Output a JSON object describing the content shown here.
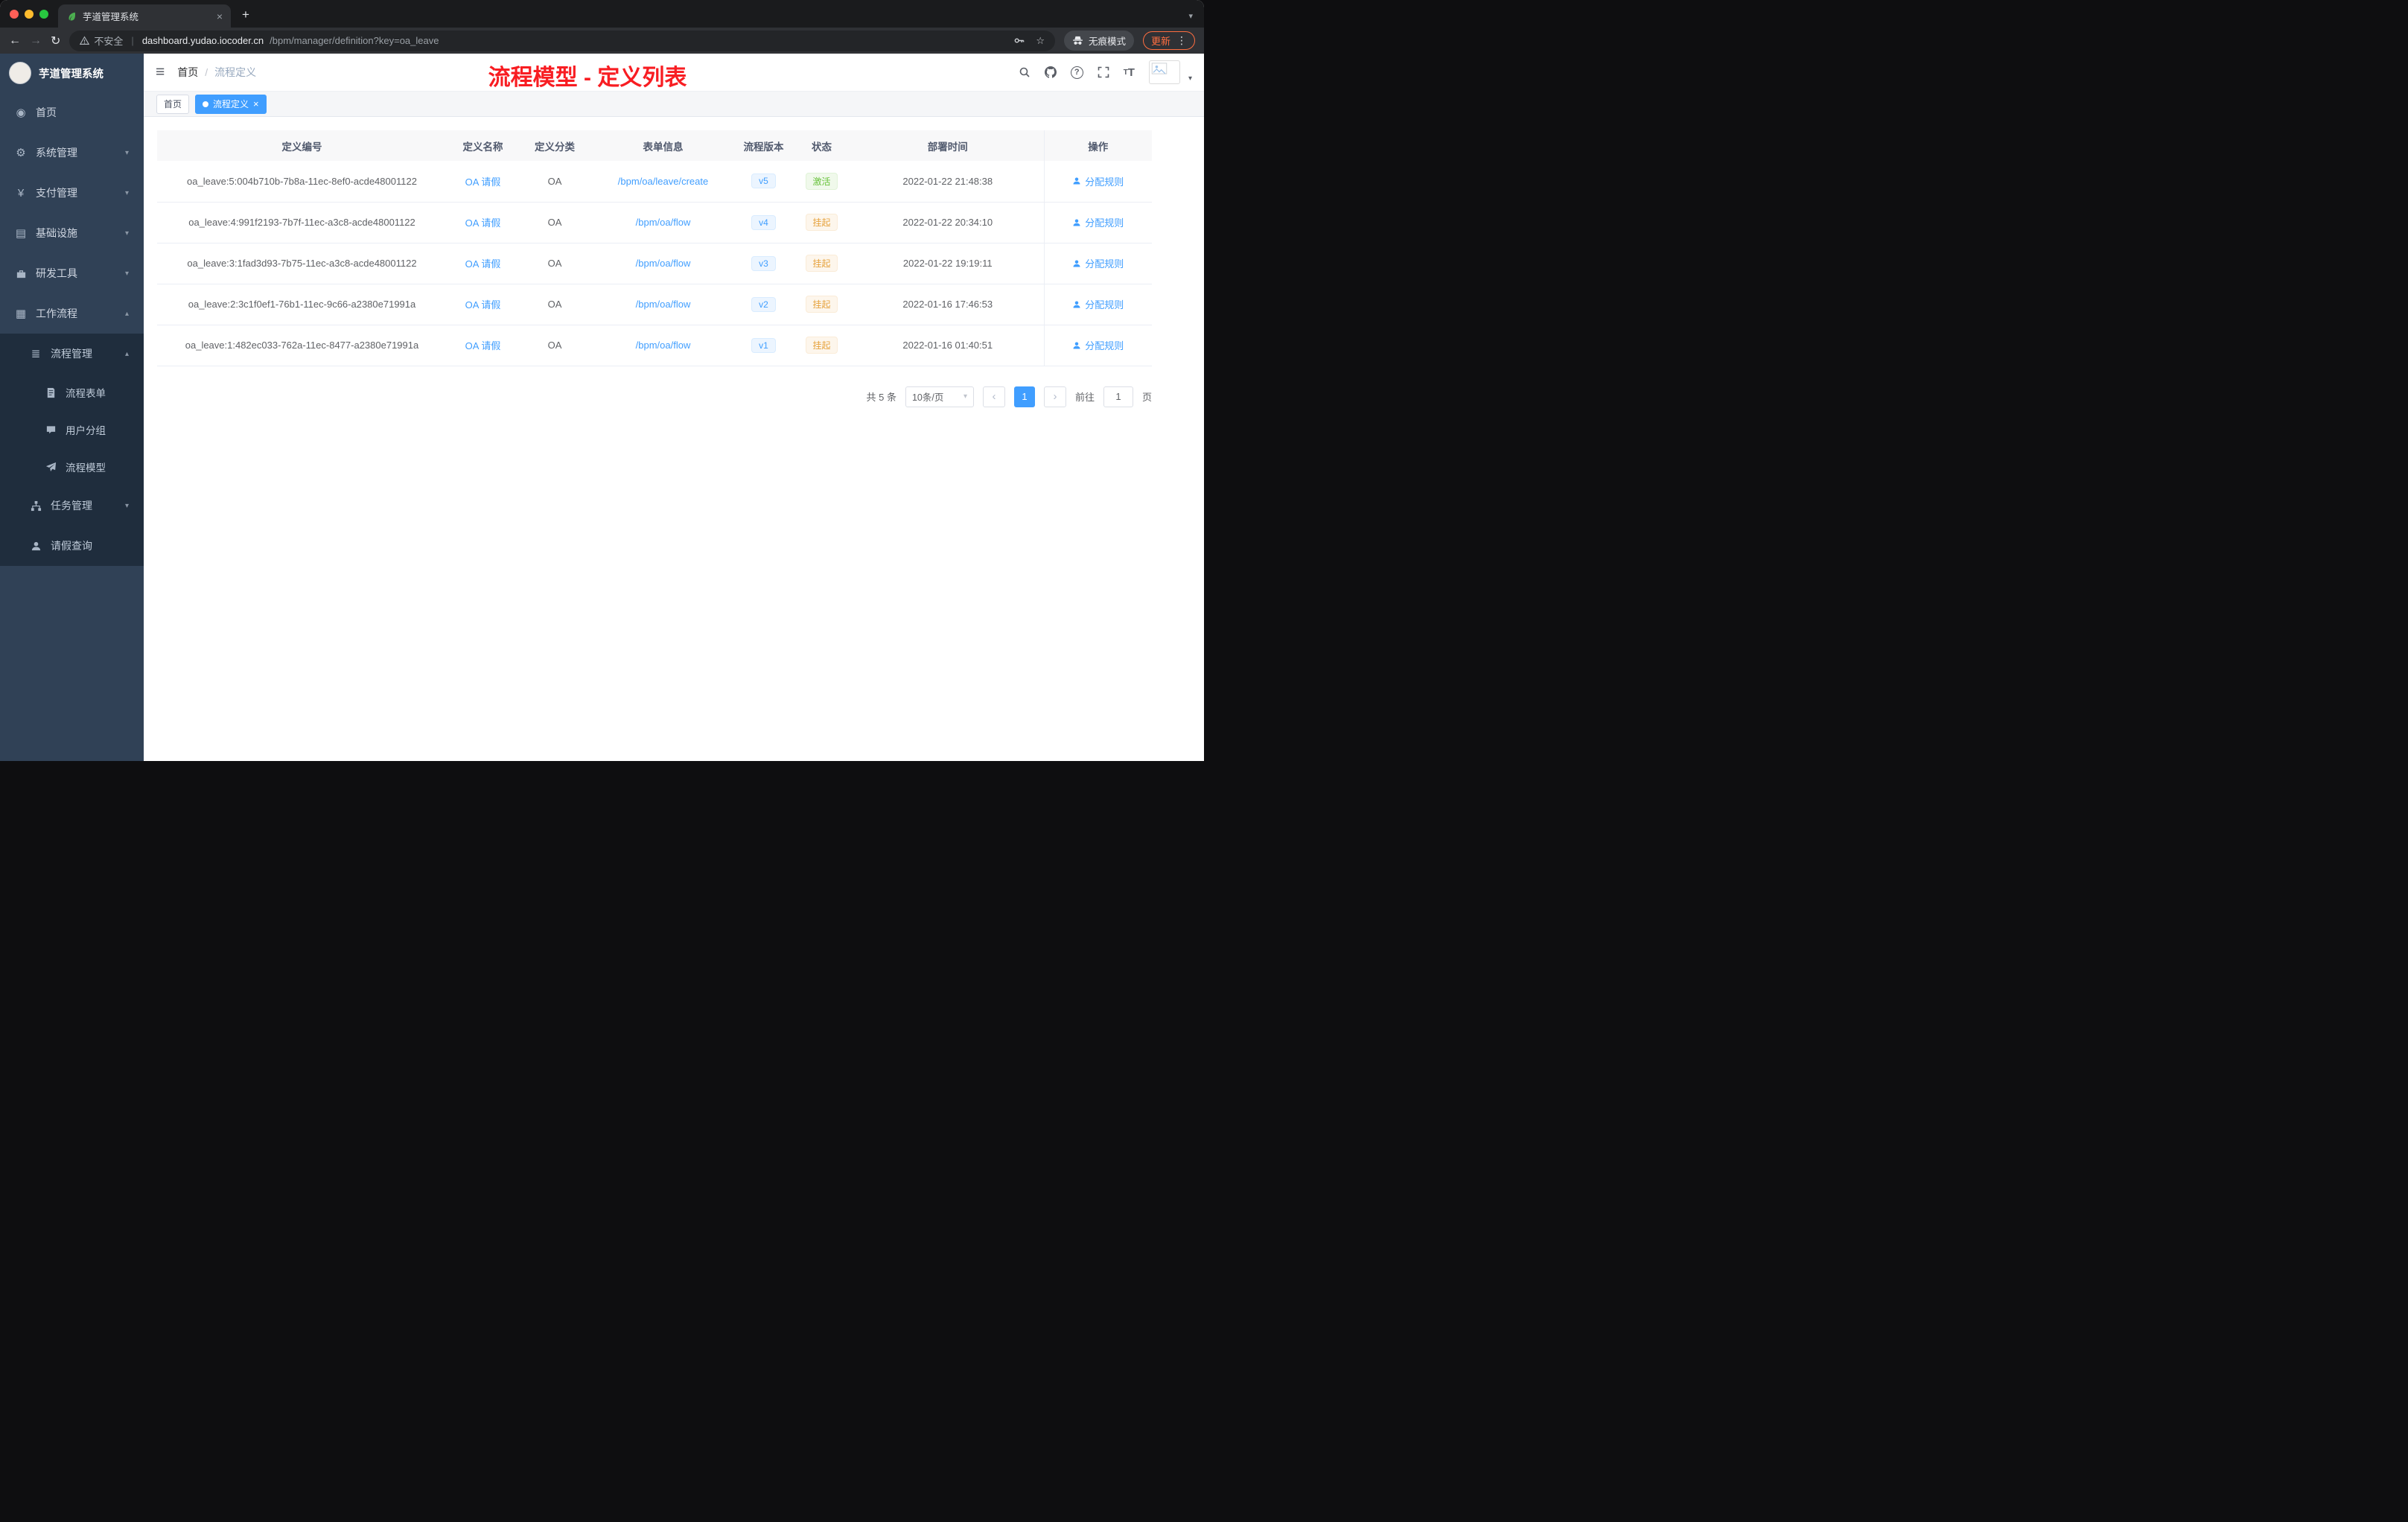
{
  "colors": {
    "accent": "#409eff",
    "title_red": "#f81d22",
    "success": "#67c23a",
    "warning": "#e6a23c",
    "sidebar_bg": "#304156",
    "submenu_bg": "#1f2d3d"
  },
  "browser": {
    "tab_title": "芋道管理系统",
    "security_label": "不安全",
    "url_host": "dashboard.yudao.iocoder.cn",
    "url_path": "/bpm/manager/definition?key=oa_leave",
    "incognito_label": "无痕模式",
    "update_label": "更新"
  },
  "icons": {
    "back": "←",
    "forward": "→",
    "reload": "↻",
    "star": "☆",
    "kebab": "⋮",
    "caret_down": "▾",
    "caret_up": "▴",
    "plus": "+",
    "close": "×",
    "question": "?",
    "hamburger": "≡",
    "prev": "‹",
    "next": "›",
    "dashboard": "◉",
    "gear": "⚙",
    "yen": "¥",
    "infrastructure": "▤",
    "workflow": "▦",
    "process_list": "≣",
    "font_small": "T",
    "font_large": "T",
    "url_divider": "|"
  },
  "sidebar": {
    "app_title": "芋道管理系统",
    "items": [
      {
        "label": "首页"
      },
      {
        "label": "系统管理",
        "chevron": "down"
      },
      {
        "label": "支付管理",
        "chevron": "down"
      },
      {
        "label": "基础设施",
        "chevron": "down"
      },
      {
        "label": "研发工具",
        "chevron": "down"
      },
      {
        "label": "工作流程",
        "chevron": "up"
      },
      {
        "label": "流程管理",
        "chevron": "up"
      },
      {
        "label": "流程表单"
      },
      {
        "label": "用户分组"
      },
      {
        "label": "流程模型"
      },
      {
        "label": "任务管理",
        "chevron": "down"
      },
      {
        "label": "请假查询"
      }
    ]
  },
  "header": {
    "breadcrumb": {
      "home": "首页",
      "separator": "/",
      "current": "流程定义"
    },
    "overlay_title": "流程模型 - 定义列表"
  },
  "tags": {
    "home": "首页",
    "active": "流程定义"
  },
  "table": {
    "columns": {
      "id": "定义编号",
      "name": "定义名称",
      "category": "定义分类",
      "form": "表单信息",
      "version": "流程版本",
      "status": "状态",
      "deploy_time": "部署时间",
      "actions": "操作"
    },
    "action_label": "分配规则",
    "rows": [
      {
        "id": "oa_leave:5:004b710b-7b8a-11ec-8ef0-acde48001122",
        "name": "OA 请假",
        "category": "OA",
        "form": "/bpm/oa/leave/create",
        "version": "v5",
        "status": "激活",
        "status_type": "success",
        "time": "2022-01-22 21:48:38"
      },
      {
        "id": "oa_leave:4:991f2193-7b7f-11ec-a3c8-acde48001122",
        "name": "OA 请假",
        "category": "OA",
        "form": "/bpm/oa/flow",
        "version": "v4",
        "status": "挂起",
        "status_type": "warning",
        "time": "2022-01-22 20:34:10"
      },
      {
        "id": "oa_leave:3:1fad3d93-7b75-11ec-a3c8-acde48001122",
        "name": "OA 请假",
        "category": "OA",
        "form": "/bpm/oa/flow",
        "version": "v3",
        "status": "挂起",
        "status_type": "warning",
        "time": "2022-01-22 19:19:11"
      },
      {
        "id": "oa_leave:2:3c1f0ef1-76b1-11ec-9c66-a2380e71991a",
        "name": "OA 请假",
        "category": "OA",
        "form": "/bpm/oa/flow",
        "version": "v2",
        "status": "挂起",
        "status_type": "warning",
        "time": "2022-01-16 17:46:53"
      },
      {
        "id": "oa_leave:1:482ec033-762a-11ec-8477-a2380e71991a",
        "name": "OA 请假",
        "category": "OA",
        "form": "/bpm/oa/flow",
        "version": "v1",
        "status": "挂起",
        "status_type": "warning",
        "time": "2022-01-16 01:40:51"
      }
    ]
  },
  "pagination": {
    "total": "共 5 条",
    "page_size": "10条/页",
    "page": "1",
    "goto_prefix": "前往",
    "goto_value": "1",
    "goto_suffix": "页"
  }
}
